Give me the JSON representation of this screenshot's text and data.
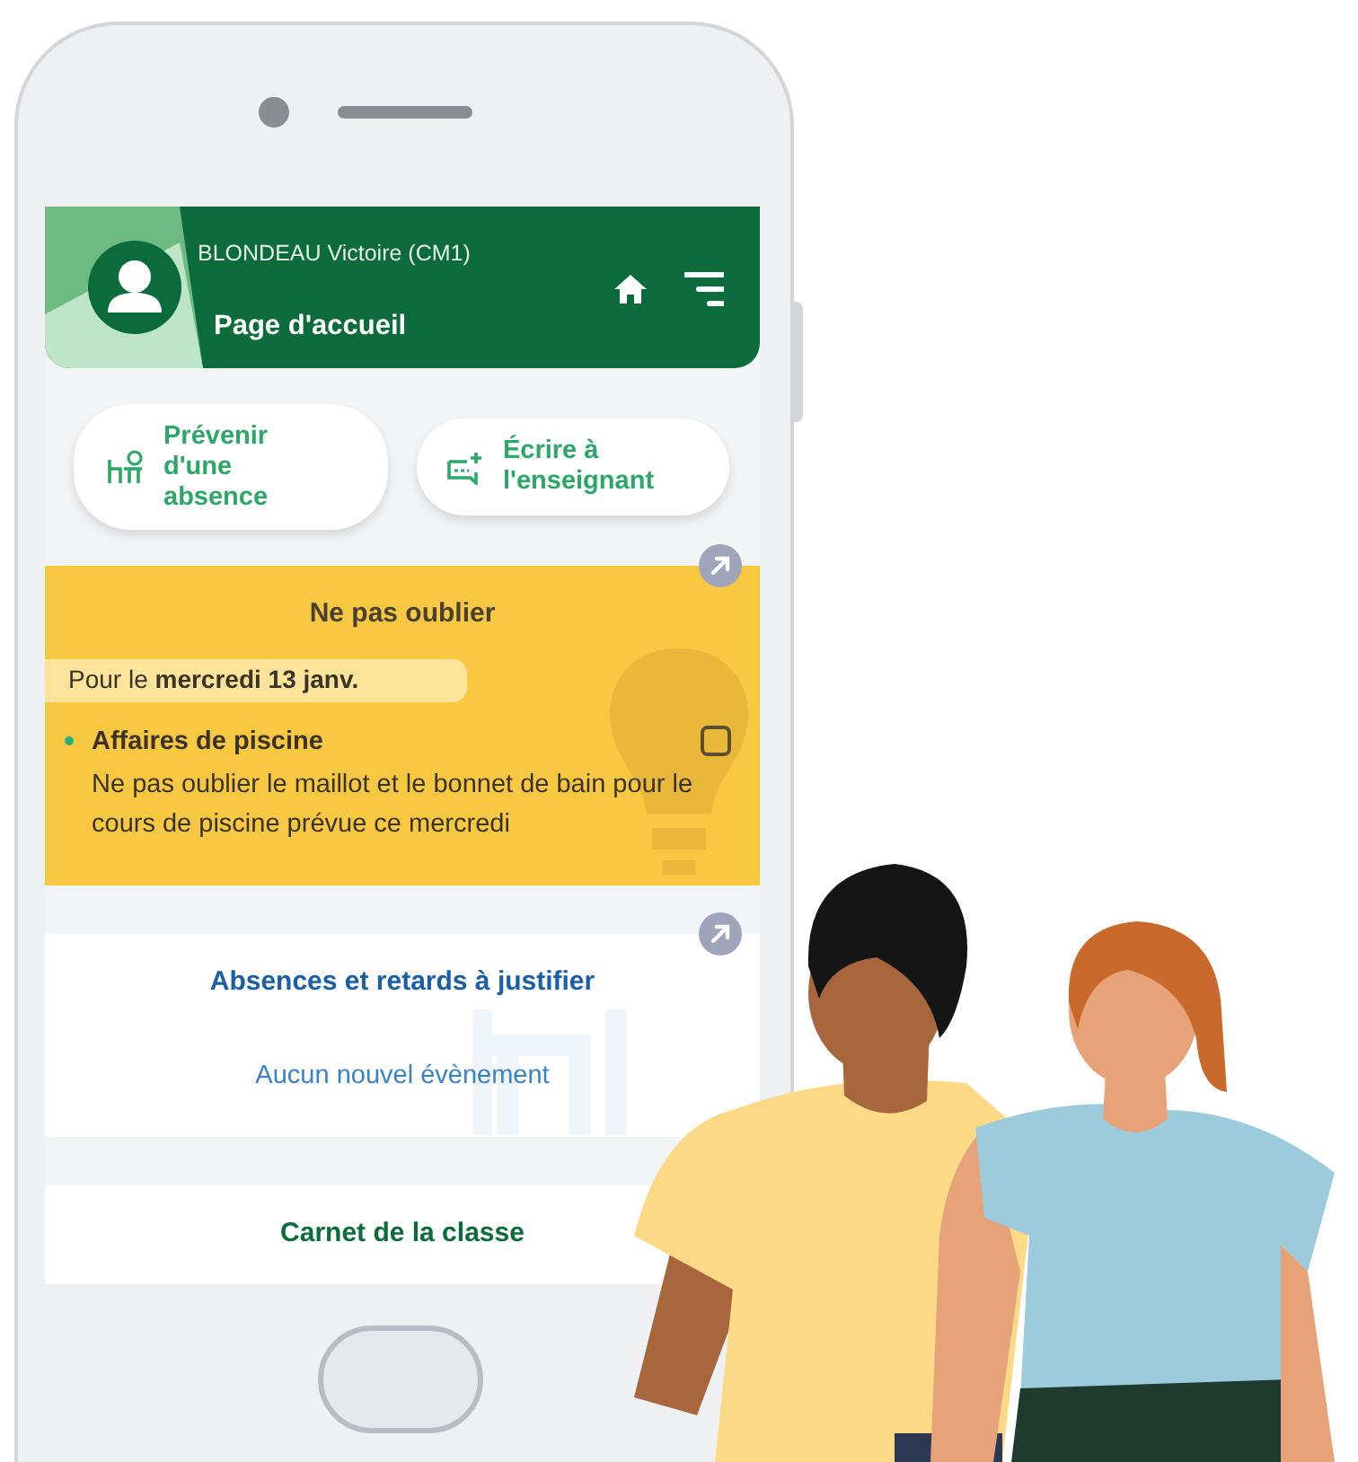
{
  "header": {
    "student": "BLONDEAU Victoire (CM1)",
    "title": "Page d'accueil"
  },
  "actions": [
    {
      "kind": "absence",
      "label": "Prévenir d'une absence"
    },
    {
      "kind": "message",
      "label": "Écrire à l'enseignant"
    }
  ],
  "reminders": {
    "title": "Ne pas oublier",
    "date": "Pour le **mercredi 13 janv.**",
    "items": [
      {
        "title": "Affaires de piscine",
        "text": "Ne pas oublier le maillot et le bonnet de bain pour le cours de piscine prévue ce mercredi",
        "checked": false
      }
    ]
  },
  "absences": {
    "title": "Absences et retards à justifier",
    "empty": "Aucun nouvel évènement"
  },
  "notebook": {
    "title": "Carnet de la classe"
  }
}
